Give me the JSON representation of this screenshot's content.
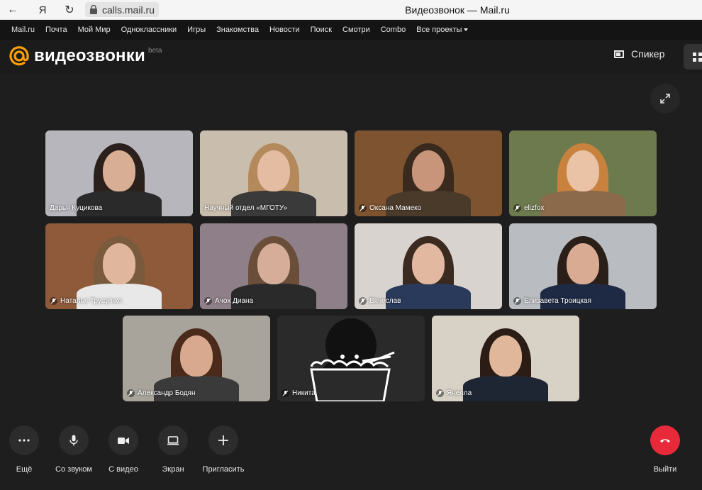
{
  "browser": {
    "url": "calls.mail.ru",
    "title": "Видеозвонок — Mail.ru",
    "yandex": "Я"
  },
  "portal": {
    "links": [
      "Mail.ru",
      "Почта",
      "Мой Мир",
      "Одноклассники",
      "Игры",
      "Знакомства",
      "Новости",
      "Поиск",
      "Смотри",
      "Combo",
      "Все проекты"
    ]
  },
  "app": {
    "brand": "видеозвонки",
    "badge": "beta",
    "speaker_label": "Спикер"
  },
  "participants": [
    {
      "name": "Дарья Куцикова",
      "muted": false,
      "bg": "#b8b6bd"
    },
    {
      "name": "Научный отдел «МГОТУ»",
      "muted": false,
      "bg": "#c9bdad"
    },
    {
      "name": "Оксана Мамеко",
      "muted": true,
      "bg": "#7d5330"
    },
    {
      "name": "elizfox",
      "muted": true,
      "bg": "#6d7a4e"
    },
    {
      "name": "Наталья Трущенко",
      "muted": true,
      "bg": "#8e5a3a"
    },
    {
      "name": "Ачох Диана",
      "muted": true,
      "bg": "#8f7f88"
    },
    {
      "name": "Вячеслав",
      "muted": true,
      "bg": "#d9d3cf"
    },
    {
      "name": "Елизавета Троицкая",
      "muted": true,
      "bg": "#b9bcc1"
    },
    {
      "name": "Александр Бодян",
      "muted": true,
      "bg": "#a8a49c"
    },
    {
      "name": "Никита",
      "muted": true,
      "bg": "#2a2a2a"
    },
    {
      "name": "Янелла",
      "muted": true,
      "bg": "#d8d1c6"
    }
  ],
  "controls": {
    "more": "Ещё",
    "mic": "Со звуком",
    "video": "С видео",
    "screen": "Экран",
    "invite": "Пригласить",
    "leave": "Выйти"
  },
  "colors": {
    "accent": "#ff9e00",
    "leave": "#e8293a",
    "background": "#1e1e1e"
  }
}
